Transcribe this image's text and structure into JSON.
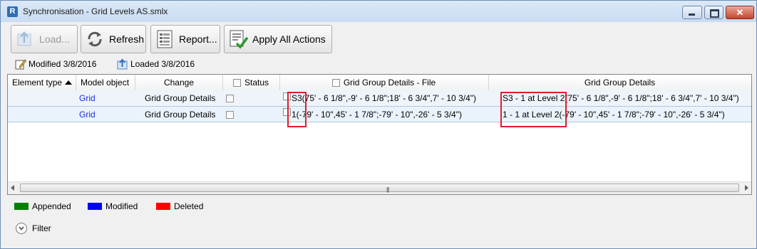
{
  "window": {
    "title": "Synchronisation - Grid Levels AS.smlx",
    "app_icon": "R"
  },
  "toolbar": {
    "load_label": "Load...",
    "refresh_label": "Refresh",
    "report_label": "Report...",
    "apply_label": "Apply All Actions"
  },
  "status": {
    "modified": "Modified 3/8/2016",
    "loaded": "Loaded 3/8/2016"
  },
  "grid": {
    "columns": {
      "element_type": "Element type",
      "model_object": "Model object",
      "change": "Change",
      "status": "Status",
      "file_details": "Grid Group Details - File",
      "details": "Grid Group Details"
    },
    "rows": [
      {
        "model_object": "Grid",
        "change": "Grid Group Details",
        "file_details": "S3(75' - 6 1/8\",-9' - 6 1/8\";18' - 6 3/4\",7' - 10 3/4\")",
        "details": "S3 - 1 at Level 2(75' - 6 1/8\",-9' - 6 1/8\";18' - 6 3/4\",7' - 10 3/4\")"
      },
      {
        "model_object": "Grid",
        "change": "Grid Group Details",
        "file_details": "1(-79' - 10\",45' - 1 7/8\";-79' - 10\",-26' - 5 3/4\")",
        "details": "1 - 1 at Level 2(-79' - 10\",45' - 1 7/8\";-79' - 10\",-26' - 5 3/4\")"
      }
    ]
  },
  "legend": {
    "appended": "Appended",
    "appended_color": "#008000",
    "modified": "Modified",
    "modified_color": "#0000ff",
    "deleted": "Deleted",
    "deleted_color": "#ff0000"
  },
  "filter": {
    "label": "Filter"
  }
}
